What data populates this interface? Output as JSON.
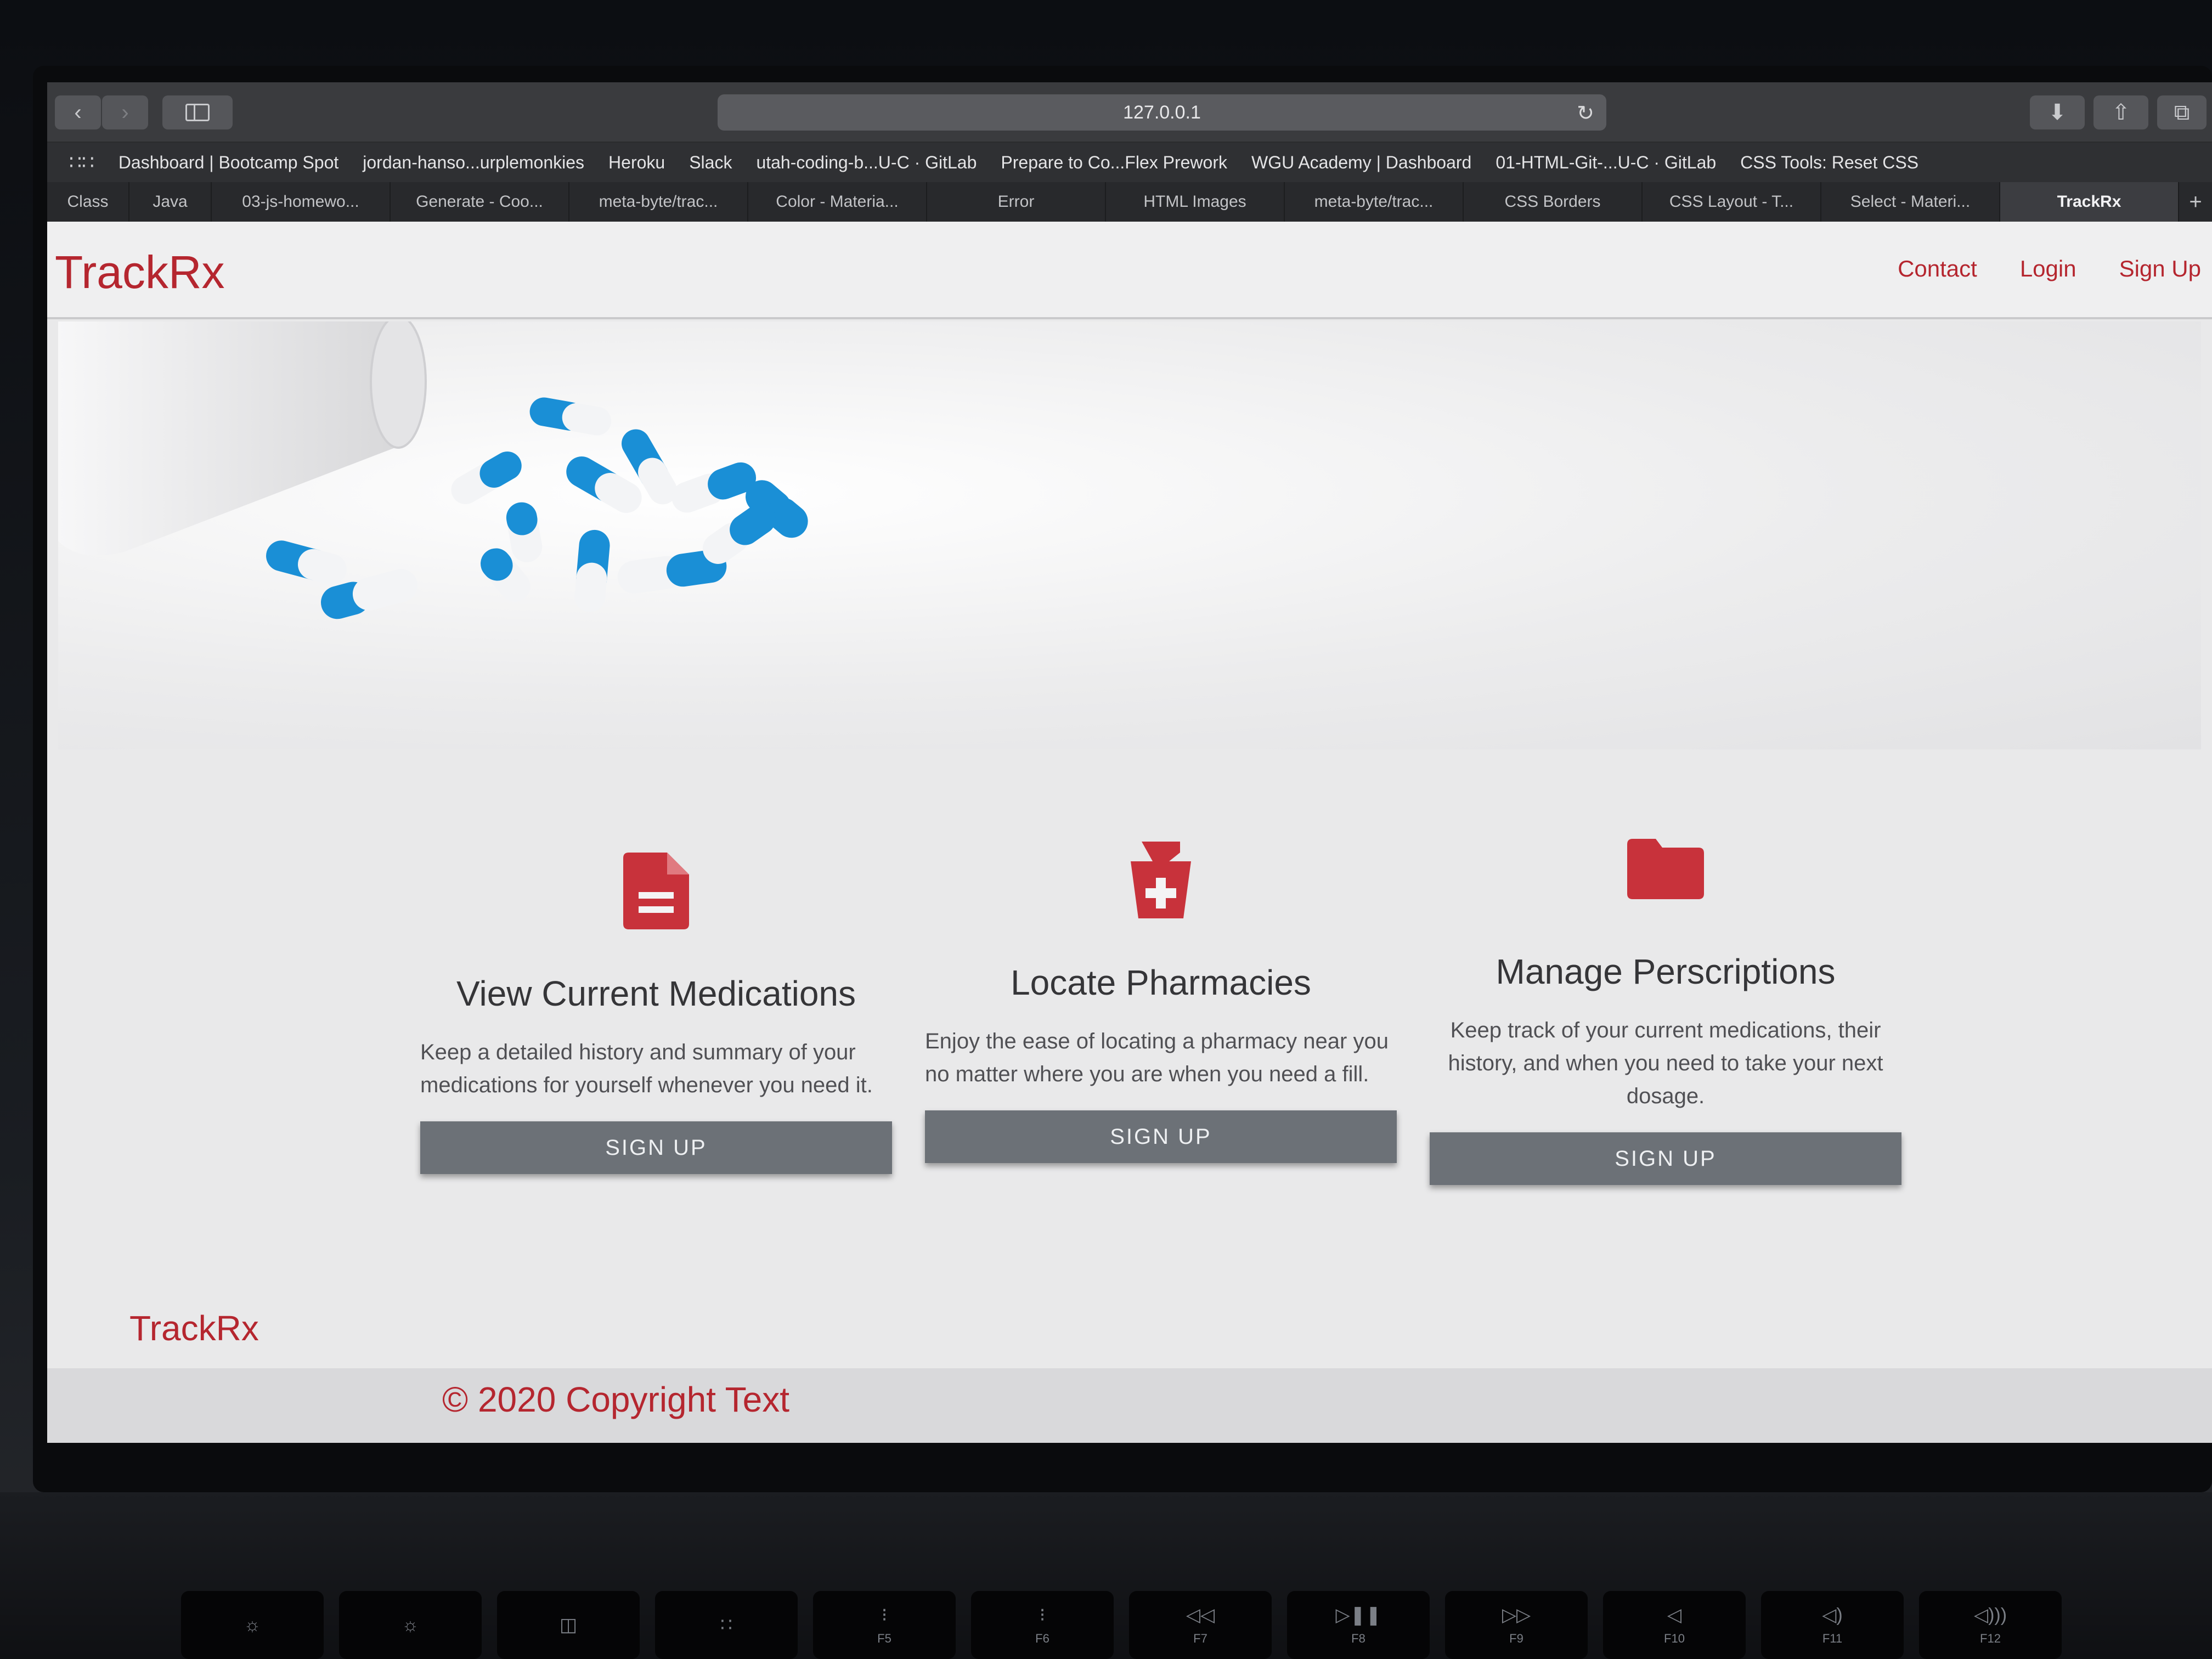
{
  "browser": {
    "url": "127.0.0.1",
    "bookmarks": [
      "Dashboard | Bootcamp Spot",
      "jordan-hanso...urplemonkies",
      "Heroku",
      "Slack",
      "utah-coding-b...U-C · GitLab",
      "Prepare to Co...Flex Prework",
      "WGU Academy | Dashboard",
      "01-HTML-Git-...U-C · GitLab",
      "CSS Tools: Reset CSS"
    ],
    "tabs": [
      "Class",
      "Java",
      "03-js-homewo...",
      "Generate - Coo...",
      "meta-byte/trac...",
      "Color - Materia...",
      "Error",
      "HTML Images",
      "meta-byte/trac...",
      "CSS Borders",
      "CSS Layout - T...",
      "Select - Materi...",
      "TrackRx"
    ],
    "active_tab_index": 12
  },
  "navbar": {
    "brand": "TrackRx",
    "links": [
      "Contact",
      "Login",
      "Sign Up"
    ]
  },
  "features": [
    {
      "icon": "document-icon",
      "title": "View Current Medications",
      "description": "Keep a detailed history and summary of your medications for yourself whenever you need it.",
      "button": "SIGN UP"
    },
    {
      "icon": "pharmacy-icon",
      "title": "Locate Pharmacies",
      "description": "Enjoy the ease of locating a pharmacy near you no matter where you are when you need a fill.",
      "button": "SIGN UP"
    },
    {
      "icon": "folder-icon",
      "title": "Manage Perscriptions",
      "description": "Keep track of your current medications, their history, and when you need to take your next dosage.",
      "button": "SIGN UP"
    }
  ],
  "footer": {
    "brand": "TrackRx",
    "copyright": "© 2020 Copyright Text"
  },
  "keyboard": {
    "keys": [
      "F5",
      "F6",
      "F7",
      "F8",
      "F9",
      "F10",
      "F11",
      "F12"
    ]
  },
  "colors": {
    "brand": "#b5262f",
    "button": "#6c7177",
    "pill_blue": "#1a8fd6"
  }
}
